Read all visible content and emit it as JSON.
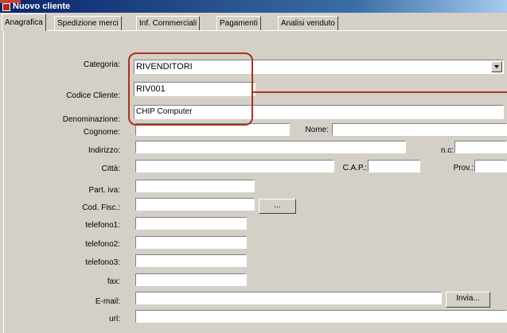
{
  "window": {
    "title": "Nuovo cliente"
  },
  "tabs": [
    "Anagrafica",
    "Spedizione merci",
    "Inf. Commerciali",
    "Pagamenti",
    "Analisi venduto"
  ],
  "form": {
    "categoria": {
      "label": "Categoria:",
      "value": "RIVENDITORI"
    },
    "codice": {
      "label": "Codice Cliente:",
      "value": "RIV001"
    },
    "denominazione": {
      "label": "Denominazione:",
      "value": "CHIP Computer"
    },
    "cognome": {
      "label": "Cognome:",
      "value": ""
    },
    "nome": {
      "label": "Nome:",
      "value": ""
    },
    "indirizzo": {
      "label": "Indirizzo:",
      "value": ""
    },
    "nc": {
      "label": "n.c:",
      "value": ""
    },
    "citta": {
      "label": "Città:",
      "value": ""
    },
    "cap": {
      "label": "C.A.P.:",
      "value": ""
    },
    "prov": {
      "label": "Prov.:",
      "value": ""
    },
    "piva": {
      "label": "Part. iva:",
      "value": ""
    },
    "codfisc": {
      "label": "Cod. Fisc.:",
      "value": "",
      "button": "..."
    },
    "tel1": {
      "label": "telefono1:",
      "value": ""
    },
    "tel2": {
      "label": "telefono2:",
      "value": ""
    },
    "tel3": {
      "label": "telefono3:",
      "value": ""
    },
    "fax": {
      "label": "fax:",
      "value": ""
    },
    "email": {
      "label": "E-mail:",
      "value": "",
      "button": "Invia..."
    },
    "url": {
      "label": "url:",
      "value": ""
    }
  }
}
